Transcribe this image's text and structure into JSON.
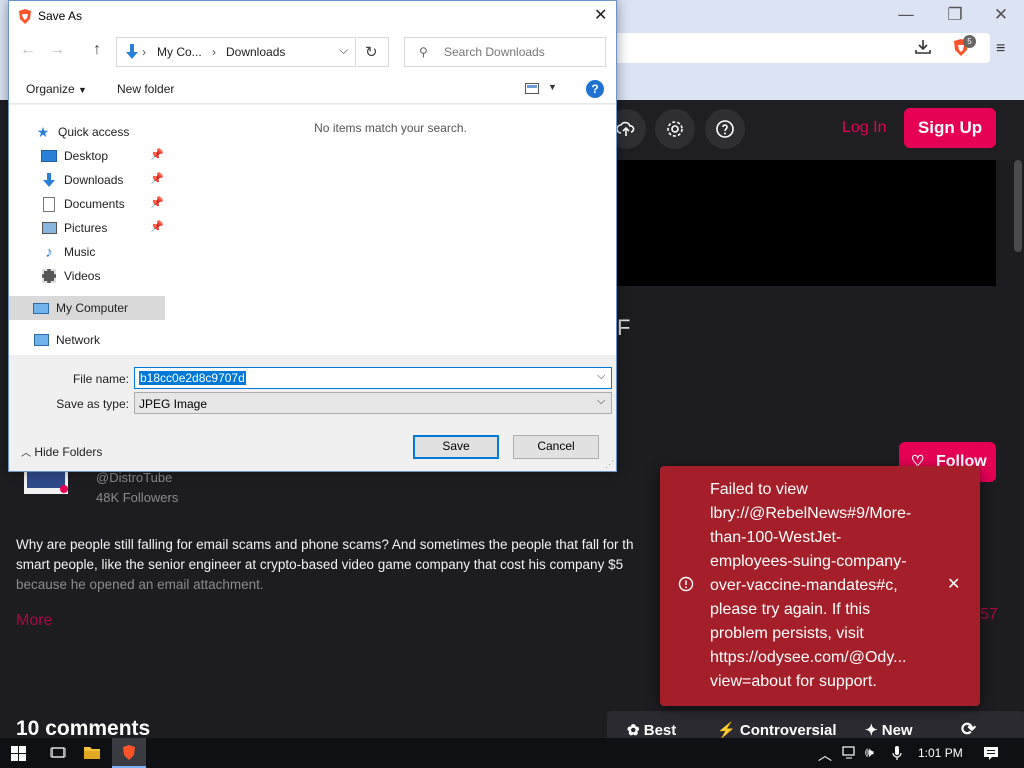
{
  "browser": {
    "win_controls": {
      "minimize": "—",
      "maximize": "❐",
      "close": "✕"
    },
    "brave_badge": "5"
  },
  "site": {
    "login_label": "Log In",
    "signup_label": "Sign Up",
    "partial_title_char": "F",
    "follow_label": "Follow",
    "channel_handle": "@DistroTube",
    "followers": "48K Followers",
    "description_lines": [
      "Why are people still falling for email scams and phone scams? And sometimes the people that fall for th",
      "smart people, like the senior engineer at crypto-based video game company that cost his company $5",
      "because he opened an email attachment."
    ],
    "more_label": "More",
    "partial_count": "57",
    "comments_heading": "10 comments",
    "sort": {
      "best": "Best",
      "controversial": "Controversial",
      "new": "New"
    }
  },
  "toast": {
    "lines": [
      "Failed to view",
      "lbry://@RebelNews#9/More-",
      "than-100-WestJet-",
      "employees-suing-company-",
      "over-vaccine-mandates#c,",
      "please try again. If this",
      "problem persists, visit",
      "https://odysee.com/@Ody...",
      "view=about for support."
    ]
  },
  "dialog": {
    "title": "Save As",
    "breadcrumb": [
      "My Co...",
      "Downloads"
    ],
    "search_placeholder": "Search Downloads",
    "organize_label": "Organize",
    "new_folder_label": "New folder",
    "empty_message": "No items match your search.",
    "tree": {
      "quick_access": "Quick access",
      "desktop": "Desktop",
      "downloads": "Downloads",
      "documents": "Documents",
      "pictures": "Pictures",
      "music": "Music",
      "videos": "Videos",
      "my_computer": "My Computer",
      "network": "Network"
    },
    "file_name_label": "File name:",
    "file_name_value": "b18cc0e2d8c9707d",
    "save_type_label": "Save as type:",
    "save_type_value": "JPEG Image",
    "hide_folders_label": "Hide Folders",
    "save_label": "Save",
    "cancel_label": "Cancel"
  },
  "taskbar": {
    "time": "1:01 PM"
  },
  "colors": {
    "accent": "#e50054",
    "toast": "#a51f2b",
    "win_blue": "#0078d7"
  }
}
